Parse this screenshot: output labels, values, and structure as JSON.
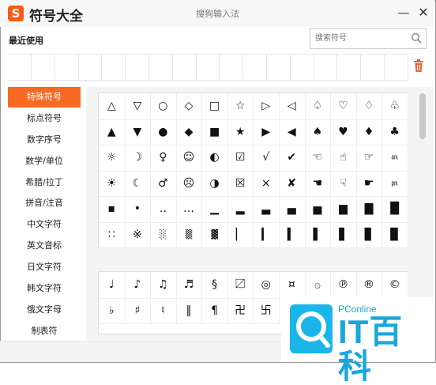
{
  "window": {
    "app_title": "符号大全",
    "subtitle": "搜狗输入法",
    "minimize_glyph": "—",
    "close_glyph": "✕"
  },
  "recent": {
    "label": "最近使用",
    "search_placeholder": "搜索符号",
    "cell_count": 17
  },
  "categories": [
    {
      "label": "特殊符号",
      "active": true
    },
    {
      "label": "标点符号",
      "active": false
    },
    {
      "label": "数字序号",
      "active": false
    },
    {
      "label": "数学/单位",
      "active": false
    },
    {
      "label": "希腊/拉丁",
      "active": false
    },
    {
      "label": "拼音/注音",
      "active": false
    },
    {
      "label": "中文字符",
      "active": false
    },
    {
      "label": "英文音标",
      "active": false
    },
    {
      "label": "日文字符",
      "active": false
    },
    {
      "label": "韩文字符",
      "active": false
    },
    {
      "label": "俄文字母",
      "active": false
    },
    {
      "label": "制表符",
      "active": false
    }
  ],
  "symbol_grid_1": [
    [
      "△",
      "▽",
      "○",
      "◇",
      "□",
      "☆",
      "▷",
      "◁",
      "♤",
      "♡",
      "♢",
      "♧"
    ],
    [
      "▲",
      "▼",
      "●",
      "◆",
      "■",
      "★",
      "▶",
      "◀",
      "♠",
      "♥",
      "♦",
      "♣"
    ],
    [
      "☼",
      "☽",
      "♀",
      "☺",
      "◐",
      "☑",
      "√",
      "✔",
      "☜",
      "☝",
      "☞",
      "㏂"
    ],
    [
      "☀",
      "☾",
      "♂",
      "☹",
      "◑",
      "☒",
      "×",
      "✘",
      "☚",
      "☟",
      "☛",
      "㏘"
    ],
    [
      "▪",
      "•",
      "‥",
      "…",
      "▁",
      "▂",
      "▃",
      "▄",
      "▅",
      "▆",
      "▇",
      "█"
    ],
    [
      "∷",
      "※",
      "░",
      "▒",
      "▓",
      "▏",
      "▎",
      "▍",
      "▌",
      "▋",
      "▊",
      "▉"
    ]
  ],
  "symbol_grid_2": [
    [
      "♩",
      "♪",
      "♫",
      "♬",
      "§",
      "〼",
      "◎",
      "¤",
      "۞",
      "℗",
      "®",
      "©"
    ],
    [
      "♭",
      "♯",
      "♮",
      "‖",
      "¶",
      "卍",
      "卐",
      "",
      "",
      "",
      "",
      ""
    ]
  ],
  "watermark": {
    "brand_top": "PConline",
    "brand_main": "IT百科"
  }
}
